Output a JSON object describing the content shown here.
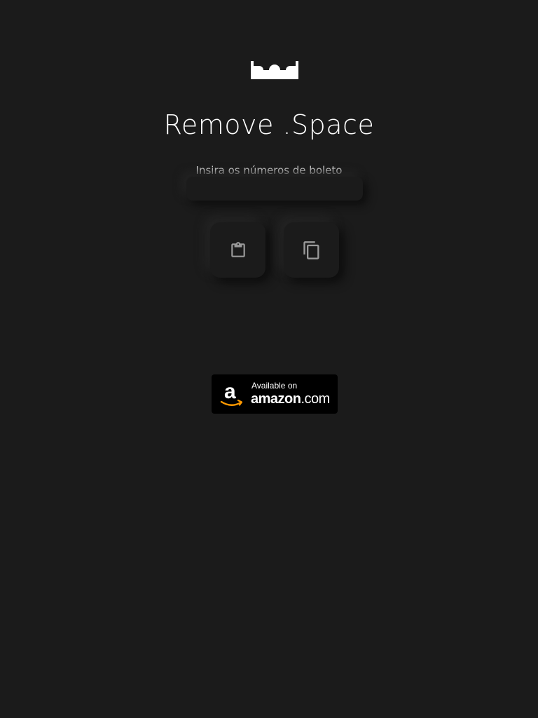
{
  "app": {
    "logo_icon": "brand-logo-icon",
    "title": "Remove .Space"
  },
  "form": {
    "input_label": "Insira os números de boleto",
    "input_value": "",
    "input_placeholder": ""
  },
  "actions": {
    "paste_icon": "clipboard-paste-icon",
    "copy_icon": "copy-icon"
  },
  "badge": {
    "available_text": "Available on",
    "store_name_bold": "amazon",
    "store_name_suffix": ".com"
  },
  "colors": {
    "background": "#1b1b1b",
    "text": "#ffffff",
    "icon": "#9a9a9a",
    "amazon_orange": "#ff9900"
  }
}
